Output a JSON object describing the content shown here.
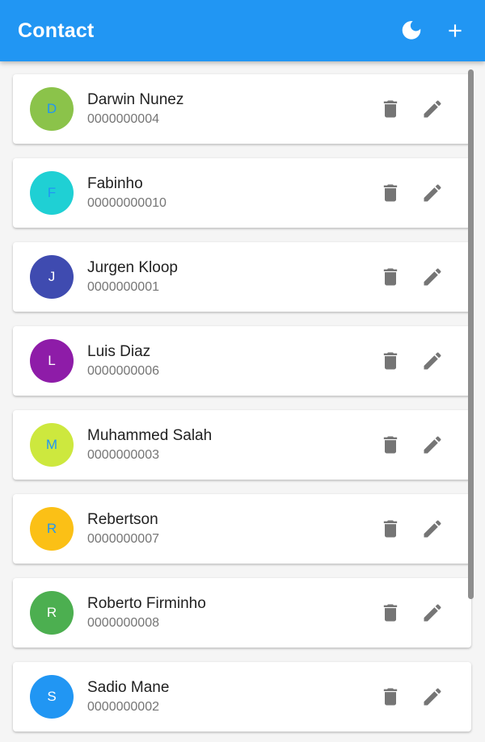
{
  "appbar": {
    "title": "Contact",
    "theme_icon": "moon-icon",
    "add_icon": "plus-icon",
    "color": "#2196f3"
  },
  "contacts": [
    {
      "initial": "D",
      "name": "Darwin Nunez",
      "phone": "0000000004",
      "avatar_color": "#8bc34a",
      "initial_color": "#2196f3"
    },
    {
      "initial": "F",
      "name": "Fabinho",
      "phone": "00000000010",
      "avatar_color": "#1fd0d4",
      "initial_color": "#2196f3"
    },
    {
      "initial": "J",
      "name": "Jurgen Kloop",
      "phone": "0000000001",
      "avatar_color": "#3f4bb0",
      "initial_color": "#ffffff"
    },
    {
      "initial": "L",
      "name": "Luis Diaz",
      "phone": "0000000006",
      "avatar_color": "#8e1ca8",
      "initial_color": "#ffffff"
    },
    {
      "initial": "M",
      "name": "Muhammed Salah",
      "phone": "0000000003",
      "avatar_color": "#cde83e",
      "initial_color": "#2196f3"
    },
    {
      "initial": "R",
      "name": "Rebertson",
      "phone": "0000000007",
      "avatar_color": "#fbc016",
      "initial_color": "#2196f3"
    },
    {
      "initial": "R",
      "name": "Roberto Firminho",
      "phone": "0000000008",
      "avatar_color": "#4caf50",
      "initial_color": "#ffffff"
    },
    {
      "initial": "S",
      "name": "Sadio Mane",
      "phone": "0000000002",
      "avatar_color": "#2196f3",
      "initial_color": "#ffffff"
    }
  ],
  "row_actions": {
    "delete_icon": "trash-icon",
    "edit_icon": "pencil-icon",
    "icon_color": "#757575"
  }
}
